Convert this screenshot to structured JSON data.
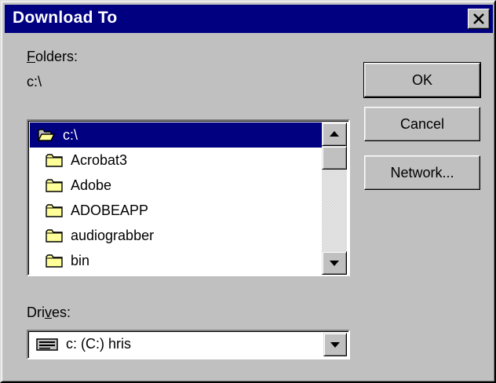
{
  "window": {
    "title": "Download To",
    "close_glyph": "✕"
  },
  "folders": {
    "label_accel": "F",
    "label_rest": "olders:",
    "current_path": "c:\\",
    "items": [
      {
        "name": "c:\\",
        "icon": "open-folder-icon",
        "selected": true
      },
      {
        "name": "Acrobat3",
        "icon": "folder-icon",
        "selected": false
      },
      {
        "name": "Adobe",
        "icon": "folder-icon",
        "selected": false
      },
      {
        "name": "ADOBEAPP",
        "icon": "folder-icon",
        "selected": false
      },
      {
        "name": "audiograbber",
        "icon": "folder-icon",
        "selected": false
      },
      {
        "name": "bin",
        "icon": "folder-icon",
        "selected": false
      }
    ]
  },
  "drives": {
    "label_pre": "Dri",
    "label_accel": "v",
    "label_post": "es:",
    "selected": "c: (C:) hris",
    "icon": "hard-drive-icon"
  },
  "buttons": {
    "ok": "OK",
    "cancel": "Cancel",
    "network": "Network..."
  },
  "colors": {
    "titlebar": "#000080",
    "face": "#c0c0c0",
    "selection": "#000080"
  }
}
